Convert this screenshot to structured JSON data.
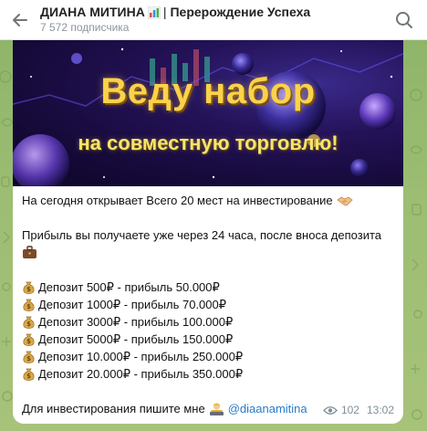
{
  "header": {
    "title_part1": "ДИАНА МИТИНА",
    "title_separator": "|",
    "title_part2": "Перерождение Успеха",
    "subscribers": "7 572 подписчика",
    "icons": [
      "back-arrow-icon",
      "chart-emoji-icon",
      "search-icon"
    ]
  },
  "message": {
    "banner": {
      "title": "Веду набор",
      "subtitle": "на совместную торговлю!"
    },
    "intro": "На сегодня открывает Всего 20 мест на инвестирование",
    "profit_line_1": "Прибыль вы получаете уже через 24 часа, после вноса депозита",
    "deposits": [
      "Депозит 500₽ - прибыль 50.000₽",
      "Депозит 1000₽ - прибыль 70.000₽",
      "Депозит 3000₽ - прибыль 100.000₽",
      "Депозит 5000₽ - прибыль 150.000₽",
      "Депозит 10.000₽ - прибыль 250.000₽",
      "Депозит 20.000₽ - прибыль 350.000₽"
    ],
    "contact_text": "Для инвестирования пишите мне",
    "contact_link": "@diaanamitina",
    "views": "102",
    "time": "13:02"
  },
  "colors": {
    "link": "#2a7bc8",
    "banner_text": "#fbd24a",
    "chat_background": "#8fb56a"
  }
}
